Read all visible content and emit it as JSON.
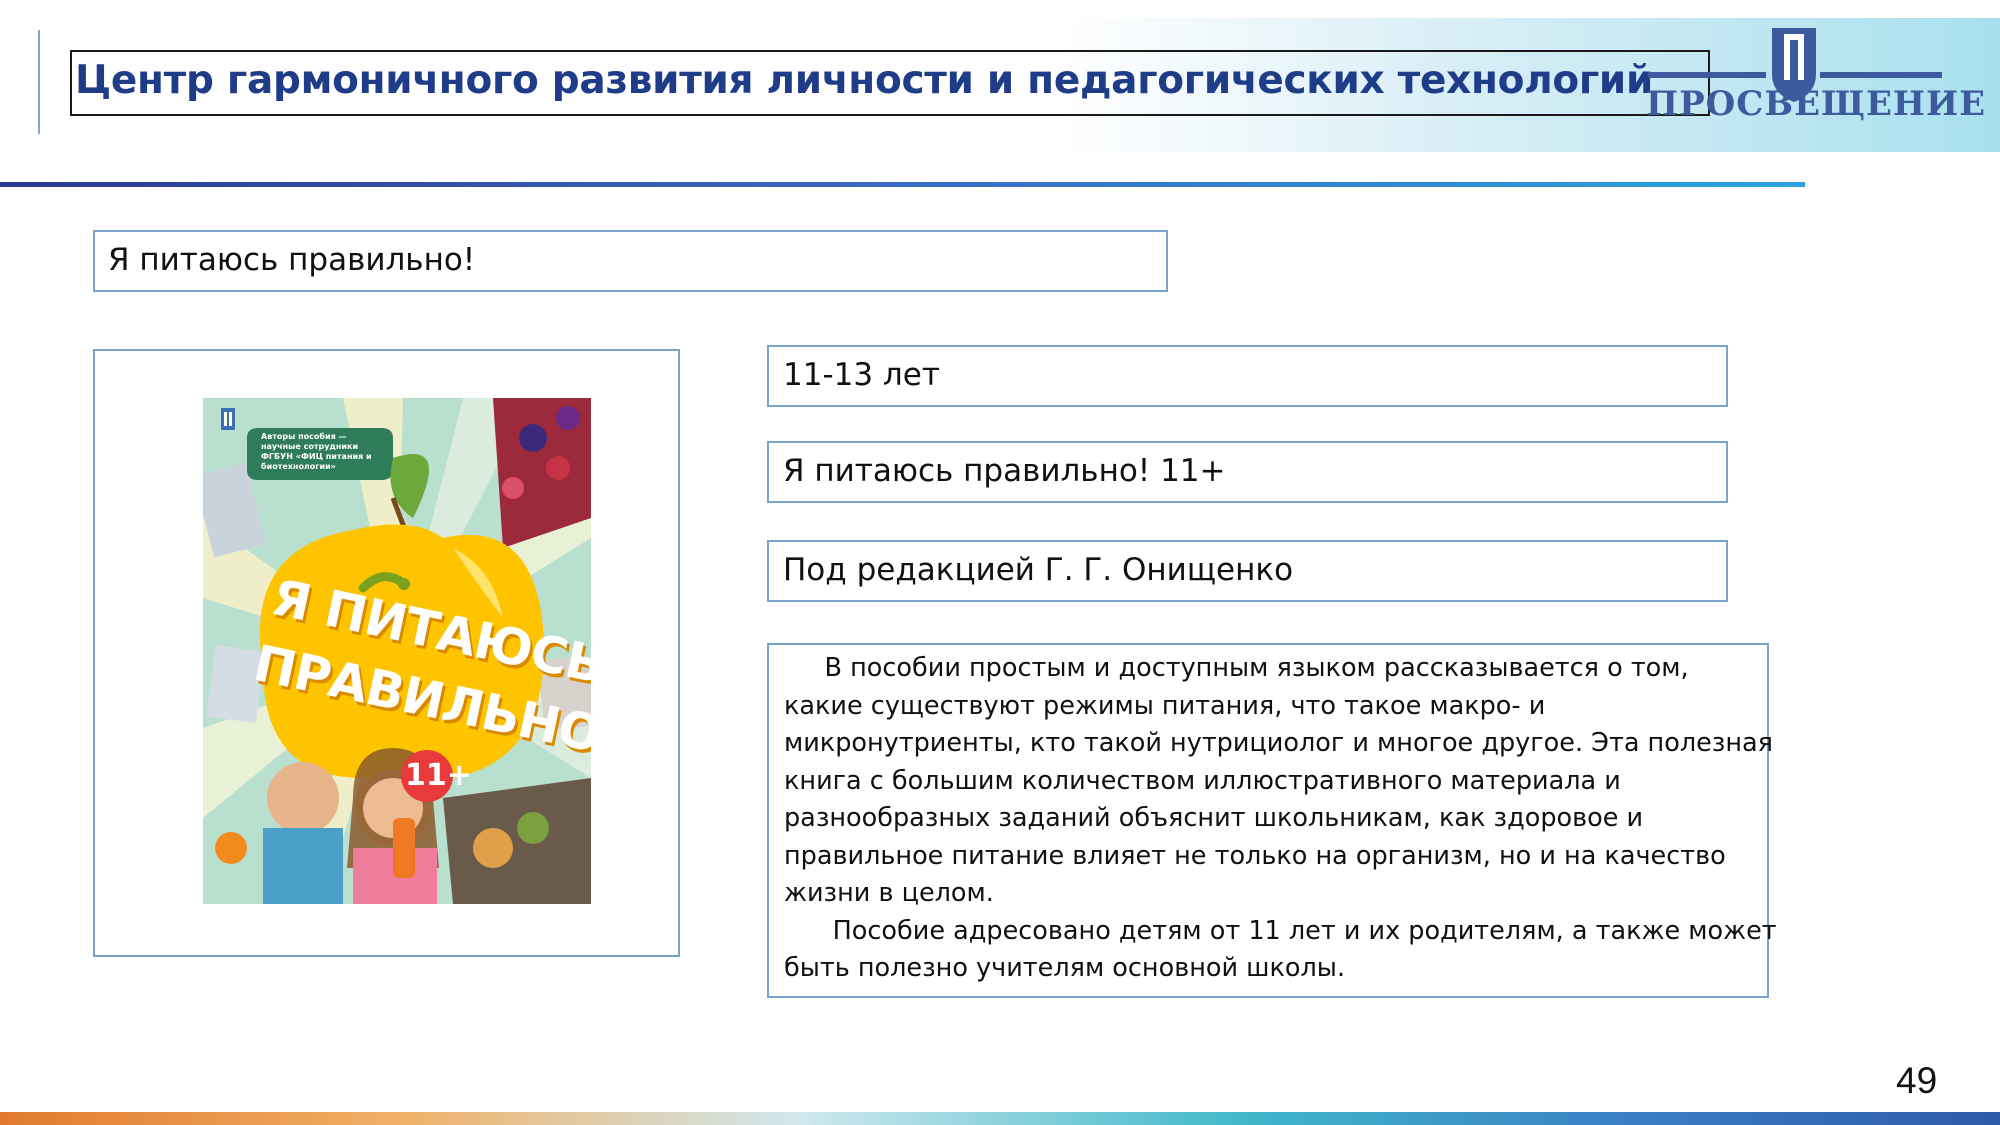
{
  "header": {
    "title": "Центр гармоничного развития личности и педагогических технологий",
    "logo_text": "ПРОСВЕЩЕНИЕ"
  },
  "book_title": "Я питаюсь правильно!",
  "details": {
    "age": "11-13 лет",
    "series": "Я питаюсь правильно! 11+",
    "editor": "Под редакцией Г. Г. Онищенко"
  },
  "description": {
    "lines": [
      "     В пособии простым и доступным языком рассказывается о том,",
      "какие существуют режимы питания, что такое макро- и",
      "микронутриенты, кто такой нутрициолог и многое другое. Эта полезная",
      "книга с большим количеством иллюстративного материала и",
      "разнообразных заданий объяснит школьникам, как здоровое и",
      "правильное питание влияет не только на организм, но и на качество",
      "жизни в целом.",
      "      Пособие адресовано детям от 11 лет и их родителям, а также может",
      "быть полезно учителям основной школы."
    ]
  },
  "cover": {
    "publisher_note": "Авторы пособия — научные сотрудники ФГБУН «ФИЦ питания и биотехнологии»",
    "title_line1": "Я ПИТАЮСЬ",
    "title_line2": "ПРАВИЛЬНО!",
    "badge": "11+"
  },
  "page_number": "49",
  "colors": {
    "title": "#1f3c88",
    "box_border": "#7aa3cc",
    "cover_bg": "#b9dfcf",
    "apple": "#ffc400",
    "cover_title": "#ffffff"
  }
}
